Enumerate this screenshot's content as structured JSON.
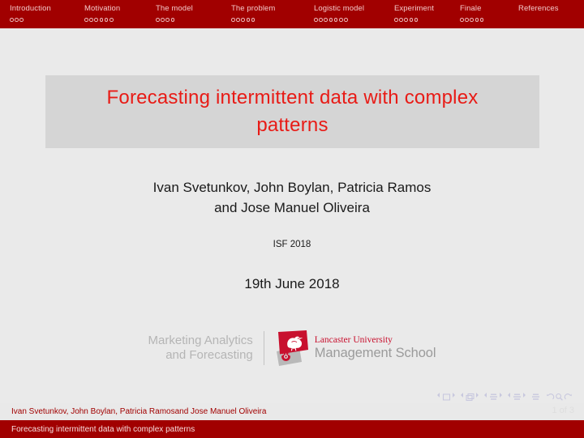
{
  "header": {
    "sections": [
      {
        "label": "Introduction",
        "dots": 3
      },
      {
        "label": "Motivation",
        "dots": 6
      },
      {
        "label": "The model",
        "dots": 4
      },
      {
        "label": "The problem",
        "dots": 5
      },
      {
        "label": "Logistic model",
        "dots": 7
      },
      {
        "label": "Experiment",
        "dots": 5
      },
      {
        "label": "Finale",
        "dots": 5
      },
      {
        "label": "References",
        "dots": 0
      }
    ],
    "background_color": "#a10000",
    "text_color": "#f3c9c9"
  },
  "title": {
    "text": "Forecasting intermittent data with complex patterns",
    "color": "#e81b16",
    "box_color": "#d5d5d5"
  },
  "authors": {
    "line1": "Ivan Svetunkov, John Boylan, Patricia Ramos",
    "line2": "and Jose Manuel Oliveira"
  },
  "venue": "ISF 2018",
  "date": "19th June 2018",
  "logos": {
    "maf_line1": "Marketing Analytics",
    "maf_line2": "and Forecasting",
    "maf_color": "#b5b5b5",
    "lancaster_name": "Lancaster University",
    "lancaster_school": "Management School",
    "lancaster_red": "#c8102e",
    "lancaster_grey": "#9b9b9b"
  },
  "navigation_symbols": [
    "slide-nav-icon",
    "frame-nav-icon",
    "subsection-nav-icon",
    "section-nav-icon",
    "presentation-nav-icon",
    "back-nav-icon",
    "search-nav-icon",
    "forward-nav-icon"
  ],
  "footer": {
    "authors": "Ivan Svetunkov, John Boylan, Patricia Ramosand Jose Manuel Oliveira",
    "title": "Forecasting intermittent data with complex patterns",
    "page": "1 of 3",
    "top_background": "#e9e9e9",
    "bottom_background": "#a10000"
  }
}
